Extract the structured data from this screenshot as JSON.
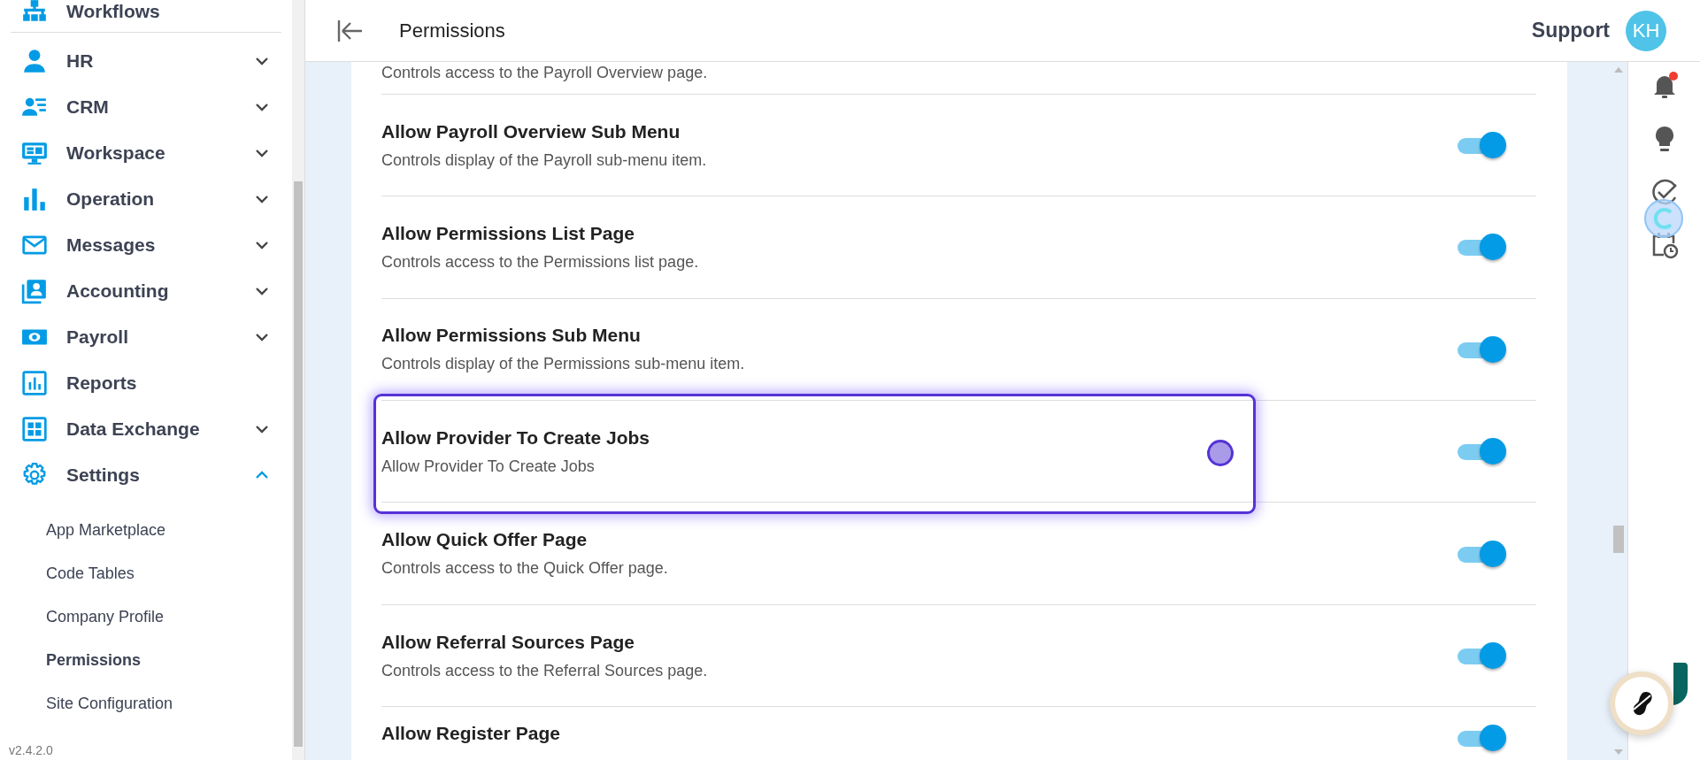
{
  "sidebar": {
    "items": [
      {
        "label": "Workflows"
      },
      {
        "label": "HR",
        "expanded": false
      },
      {
        "label": "CRM",
        "expanded": false
      },
      {
        "label": "Workspace",
        "expanded": false
      },
      {
        "label": "Operation",
        "expanded": false
      },
      {
        "label": "Messages",
        "expanded": false
      },
      {
        "label": "Accounting",
        "expanded": false
      },
      {
        "label": "Payroll",
        "expanded": false
      },
      {
        "label": "Reports"
      },
      {
        "label": "Data Exchange",
        "expanded": false
      },
      {
        "label": "Settings",
        "expanded": true,
        "children": [
          {
            "label": "App Marketplace",
            "selected": false
          },
          {
            "label": "Code Tables",
            "selected": false
          },
          {
            "label": "Company Profile",
            "selected": false
          },
          {
            "label": "Permissions",
            "selected": true
          },
          {
            "label": "Site Configuration",
            "selected": false
          }
        ]
      }
    ],
    "version": "v2.4.2.0"
  },
  "header": {
    "title": "Permissions",
    "user": "Support",
    "avatar": "KH"
  },
  "notifications": {
    "unread": true
  },
  "permissions": [
    {
      "description": "Controls access to the Payroll Overview page."
    },
    {
      "title": "Allow Payroll Overview Sub Menu",
      "description": "Controls display of the Payroll sub-menu item.",
      "on": true,
      "highlighted": false
    },
    {
      "title": "Allow Permissions List Page",
      "description": "Controls access to the Permissions list page.",
      "on": true,
      "highlighted": false
    },
    {
      "title": "Allow Permissions Sub Menu",
      "description": "Controls display of the Permissions sub-menu item.",
      "on": true,
      "highlighted": false
    },
    {
      "title": "Allow Provider To Create Jobs",
      "description": "Allow Provider To Create Jobs",
      "on": true,
      "highlighted": true
    },
    {
      "title": "Allow Quick Offer Page",
      "description": "Controls access to the Quick Offer page.",
      "on": true,
      "highlighted": false
    },
    {
      "title": "Allow Referral Sources Page",
      "description": "Controls access to the Referral Sources page.",
      "on": true,
      "highlighted": false
    },
    {
      "title": "Allow Register Page",
      "on": true,
      "highlighted": false
    }
  ]
}
